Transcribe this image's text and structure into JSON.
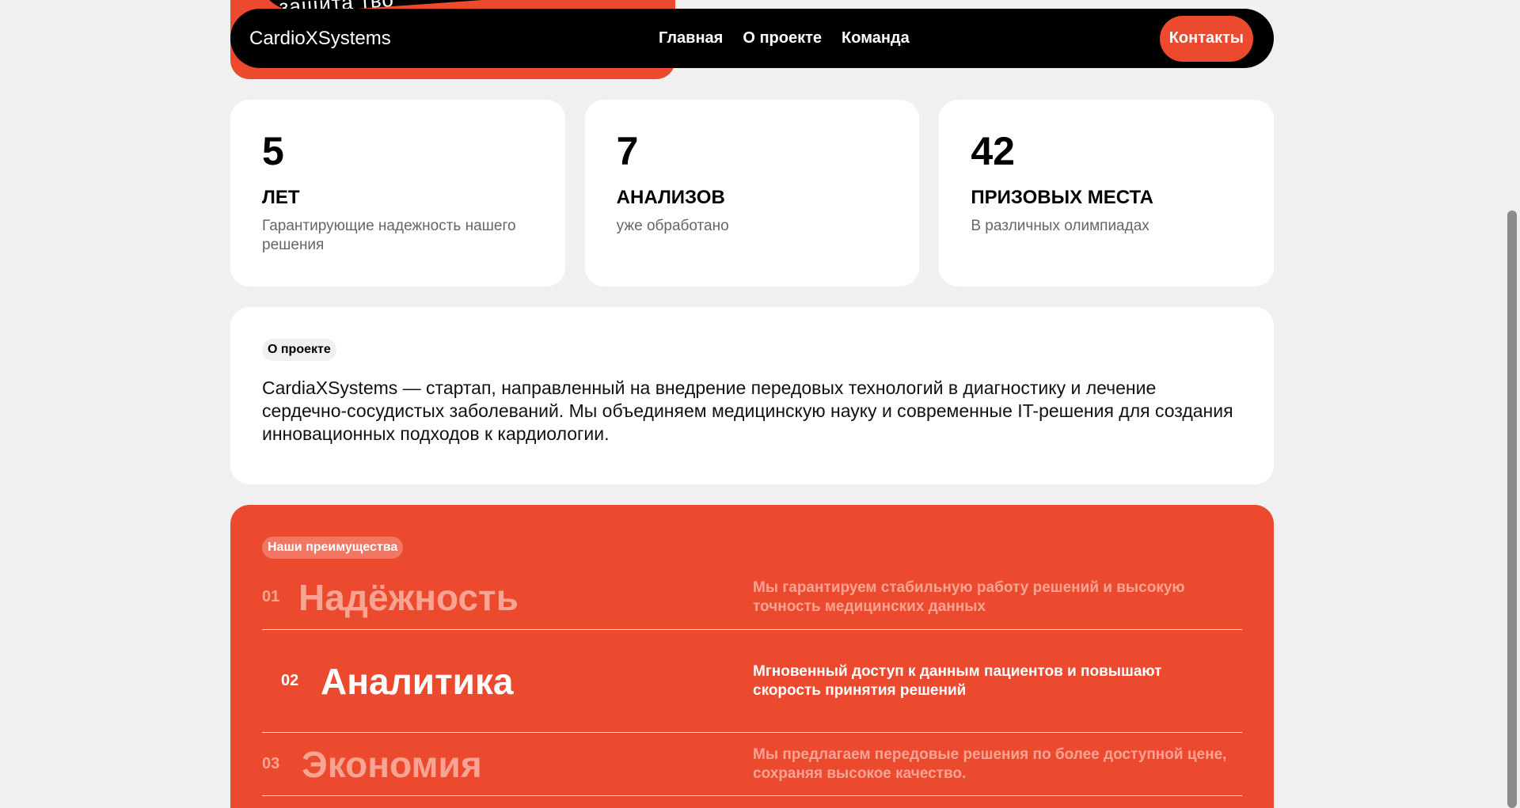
{
  "hero": {
    "fragment_text": "защита тво"
  },
  "nav": {
    "logo": "CardioXSystems",
    "links": [
      "Главная",
      "О проекте",
      "Команда"
    ],
    "contact": "Контакты"
  },
  "stats": [
    {
      "number": "5",
      "unit": "ЛЕТ",
      "desc": "Гарантирующие надежность нашего решения"
    },
    {
      "number": "7",
      "unit": "АНАЛИЗОВ",
      "desc": "уже обработано"
    },
    {
      "number": "42",
      "unit": "ПРИЗОВЫХ МЕСТА",
      "desc": "В различных олимпиадах"
    }
  ],
  "about": {
    "tag": "О проекте",
    "text": "CardiaXSystems — стартап, направленный на внедрение передовых технологий в диагностику и лечение сердечно-сосудистых заболеваний. Мы объединяем медицинскую науку и современные IT-решения для создания инновационных подходов к кардиологии."
  },
  "advantages": {
    "tag": "Наши преимущества",
    "items": [
      {
        "no": "01",
        "title": "Надёжность",
        "text": "Мы гарантируем стабильную работу решений и высокую точность медицинских данных"
      },
      {
        "no": "02",
        "title": "Аналитика",
        "text": "Мгновенный доступ к данным пациентов и повышают скорость принятия решений"
      },
      {
        "no": "03",
        "title": "Экономия",
        "text": "Мы предлагаем передовые решения по более доступной цене, сохраняя высокое качество."
      }
    ]
  },
  "colors": {
    "accent": "#ec4a2e",
    "background": "#f0f0f0",
    "nav": "#000000"
  }
}
